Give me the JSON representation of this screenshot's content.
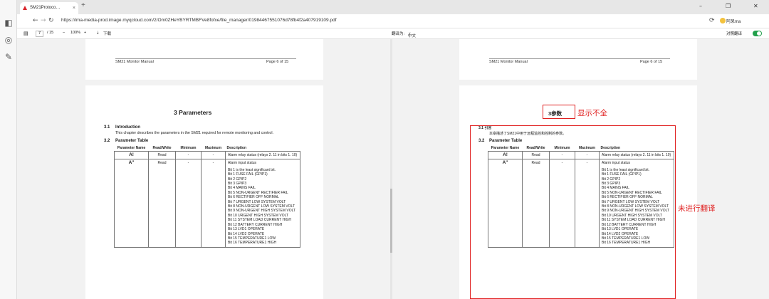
{
  "browser": {
    "tab_title": "SM21Protoco…",
    "tab_close": "×",
    "new_tab": "+",
    "url": "https://ima-media-prod.image.myqcloud.com/2/Om0ZHeYBYRTMBFVe8fofxe/file_manager/01984467551076d78fb4f2a407919109.pdf",
    "user_name": "阿呆ma",
    "window_buttons": [
      "–",
      "❐",
      "✕"
    ]
  },
  "pdf_toolbar": {
    "page_current": "7",
    "page_total": "/ 15",
    "zoom_minus": "–",
    "zoom": "100%",
    "zoom_plus": "+",
    "download": "下载",
    "translate_label": "翻译为:",
    "translate_lang": "中文",
    "compare_label": "对照翻译"
  },
  "left_page": {
    "header_left": "SM21 Monitor Manual",
    "header_right": "Page 6 of 15",
    "chapter": "3    Parameters",
    "sec31_num": "3.1",
    "sec31_title": "Introduction",
    "intro_text": "This chapter describes the parameters in the SM21 required for remote monitoring and control.",
    "sec32_num": "3.2",
    "sec32_title": "Parameter Table"
  },
  "right_page": {
    "header_left": "SM21 Monitor Manual",
    "header_right": "Page 6 of 15",
    "chapter": "3参数",
    "sec31_label": "3.1 引言",
    "intro_text": "本章描述了SM21中用于远程监控和控制的参数。",
    "sec32_num": "3.2",
    "sec32_title": "Parameter Table"
  },
  "table": {
    "headers": [
      "Parameter Name",
      "Read/Write",
      "Minimum",
      "Maximum",
      "Description"
    ],
    "row1": {
      "name": "A!",
      "rw": "Read",
      "min": "-",
      "max": "-",
      "desc": "Alarm relay status (relays 2. 11 in bits 1. 10)"
    },
    "row2": {
      "name": "A\"",
      "rw": "Read",
      "min": "-",
      "max": "-",
      "desc": "Alarm input status"
    },
    "bits": [
      "Bit 1 is the least significant bit.",
      "Bit 1  FUSE FAIL (GPIP1)",
      "Bit 2  GPIP2",
      "Bit 3  GPIP3",
      "Bit 4  MAINS FAIL",
      "Bit 5  NON-URGENT RECTIFIER FAIL",
      "Bit 6  RECTIFIER OFF NORMAL",
      "Bit 7  URGENT LOW SYSTEM VOLT",
      "Bit 8  NON-URGENT LOW SYSTEM VOLT",
      "Bit 9  NON-URGENT HIGH SYSTEM VOLT",
      "Bit 10 URGENT HIGH SYSTEM VOLT",
      "Bit 11 SYSTEM LOAD CURRENT HIGH",
      "Bit 12 BATTERY CURRENT HIGH",
      "Bit 13 LVD1 OPERATE",
      "Bit 14 LVD2 OPERATE",
      "Bit 15 TEMPERATURE1 LOW",
      "Bit 16 TEMPERATURE1 HIGH"
    ]
  },
  "annotations": {
    "incomplete": "显示不全",
    "untranslated": "未进行翻译"
  },
  "colors": {
    "annotation": "#e02020",
    "toggle": "#22a04b",
    "tab_icon": "#d9252b"
  },
  "icons": [
    "sidebar-collapse-icon",
    "tab-back-icon",
    "sidebar-search-icon",
    "sidebar-edit-icon",
    "back-icon",
    "forward-icon",
    "reload-icon",
    "extension-icon",
    "download-icon"
  ]
}
